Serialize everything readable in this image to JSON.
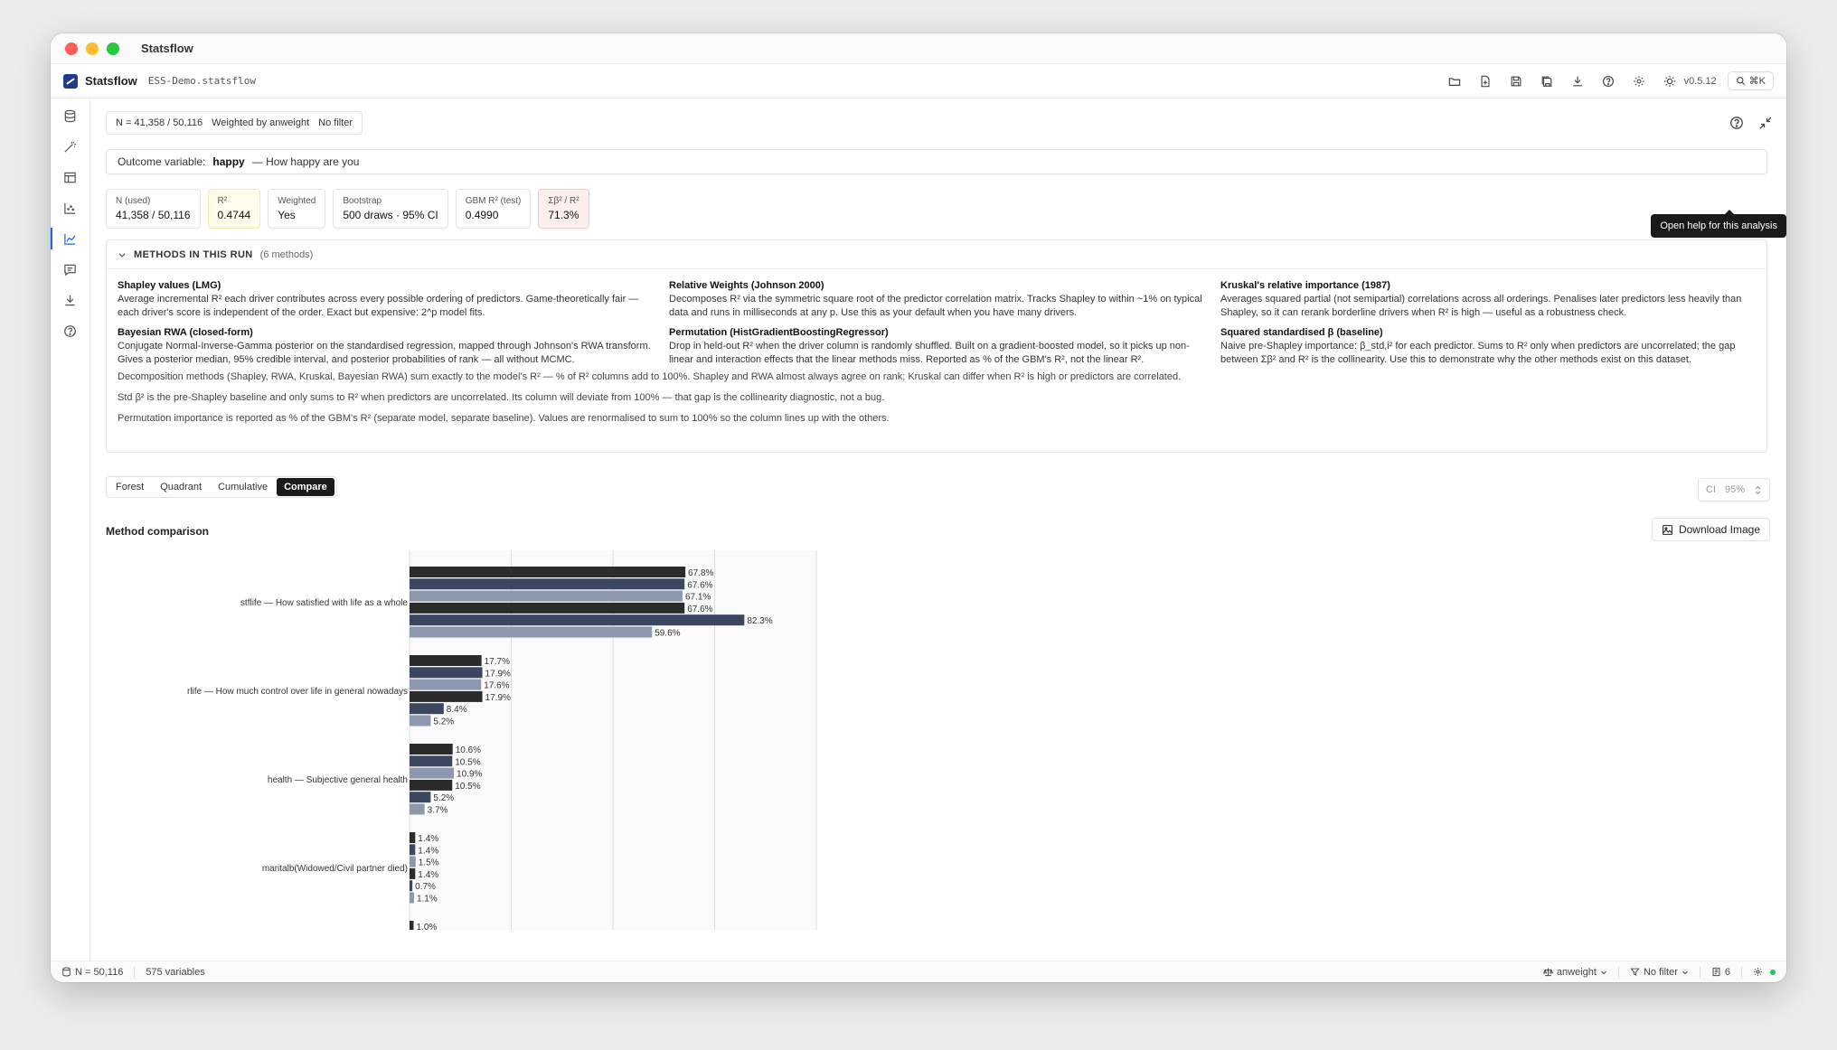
{
  "window": {
    "title": "Statsflow"
  },
  "appbar": {
    "brand": "Statsflow",
    "filename": "ESS-Demo.statsflow",
    "version": "v0.5.12",
    "cmdk": "⌘K"
  },
  "chips": {
    "n": "N = 41,358 / 50,116",
    "weighted": "Weighted by anweight",
    "filter": "No filter"
  },
  "tooltip": "Open help for this analysis",
  "outcome": {
    "label": "Outcome variable:",
    "var": "happy",
    "desc": "— How happy are you"
  },
  "stats": [
    {
      "label": "N (used)",
      "value": "41,358 / 50,116"
    },
    {
      "label": "R²",
      "value": "0.4744"
    },
    {
      "label": "Weighted",
      "value": "Yes"
    },
    {
      "label": "Bootstrap",
      "value": "500 draws · 95% CI"
    },
    {
      "label": "GBM R² (test)",
      "value": "0.4990"
    },
    {
      "label": "Σβ² / R²",
      "value": "71.3%"
    }
  ],
  "methods": {
    "title": "METHODS IN THIS RUN",
    "count": "(6 methods)",
    "items": [
      {
        "title": "Shapley values (LMG)",
        "desc": "Average incremental R² each driver contributes across every possible ordering of predictors. Game-theoretically fair — each driver's score is independent of the order. Exact but expensive: 2^p model fits."
      },
      {
        "title": "Relative Weights (Johnson 2000)",
        "desc": "Decomposes R² via the symmetric square root of the predictor correlation matrix. Tracks Shapley to within ~1% on typical data and runs in milliseconds at any p. Use this as your default when you have many drivers."
      },
      {
        "title": "Kruskal's relative importance (1987)",
        "desc": "Averages squared partial (not semipartial) correlations across all orderings. Penalises later predictors less heavily than Shapley, so it can rerank borderline drivers when R² is high — useful as a robustness check."
      },
      {
        "title": "Bayesian RWA (closed-form)",
        "desc": "Conjugate Normal-Inverse-Gamma posterior on the standardised regression, mapped through Johnson's RWA transform. Gives a posterior median, 95% credible interval, and posterior probabilities of rank — all without MCMC."
      },
      {
        "title": "Permutation (HistGradientBoostingRegressor)",
        "desc": "Drop in held-out R² when the driver column is randomly shuffled. Built on a gradient-boosted model, so it picks up non-linear and interaction effects that the linear methods miss. Reported as % of the GBM's R², not the linear R²."
      },
      {
        "title": "Squared standardised β (baseline)",
        "desc": "Naive pre-Shapley importance: β_std,i² for each predictor. Sums to R² only when predictors are uncorrelated; the gap between Σβ² and R² is the collinearity. Use this to demonstrate why the other methods exist on this dataset."
      }
    ],
    "notes": [
      "Decomposition methods (Shapley, RWA, Kruskal, Bayesian RWA) sum exactly to the model's R² — % of R² columns add to 100%. Shapley and RWA almost always agree on rank; Kruskal can differ when R² is high or predictors are correlated.",
      "Std β² is the pre-Shapley baseline and only sums to R² when predictors are uncorrelated. Its column will deviate from 100% — that gap is the collinearity diagnostic, not a bug.",
      "Permutation importance is reported as % of the GBM's R² (separate model, separate baseline). Values are renormalised to sum to 100% so the column lines up with the others."
    ]
  },
  "tabs": [
    "Forest",
    "Quadrant",
    "Cumulative",
    "Compare"
  ],
  "ci": {
    "label": "CI",
    "value": "95%"
  },
  "chart_title": "Method comparison",
  "download_label": "Download Image",
  "statusbar": {
    "n": "N = 50,116",
    "vars": "575 variables",
    "weight": "anweight",
    "filter": "No filter",
    "count": "6"
  },
  "colors": {
    "dark": "#2b2b2b",
    "navy": "#3b4660",
    "slate": "#8d97ad",
    "accent": "#2563eb"
  },
  "chart_data": {
    "type": "bar",
    "orientation": "horizontal",
    "categories": [
      "stflife — How satisfied with life as a whole",
      "rlife — How much control over life in general nowadays",
      "health — Subjective general health",
      "maritalb(Widowed/Civil partner died)",
      ""
    ],
    "series": [
      {
        "values": [
          67.8,
          17.7,
          10.6,
          1.4,
          1.0
        ],
        "color": "#2b2b2b"
      },
      {
        "values": [
          67.6,
          17.9,
          10.5,
          1.4,
          null
        ],
        "color": "#3b4660"
      },
      {
        "values": [
          67.1,
          17.6,
          10.9,
          1.5,
          null
        ],
        "color": "#8d97ad"
      },
      {
        "values": [
          67.6,
          17.9,
          10.5,
          1.4,
          null
        ],
        "color": "#2b2b2b"
      },
      {
        "values": [
          82.3,
          8.4,
          5.2,
          0.7,
          null
        ],
        "color": "#3b4660"
      },
      {
        "values": [
          59.6,
          5.2,
          3.7,
          1.1,
          null
        ],
        "color": "#8d97ad"
      }
    ],
    "value_suffix": "%",
    "xlim": [
      0,
      100
    ],
    "grid": true
  }
}
